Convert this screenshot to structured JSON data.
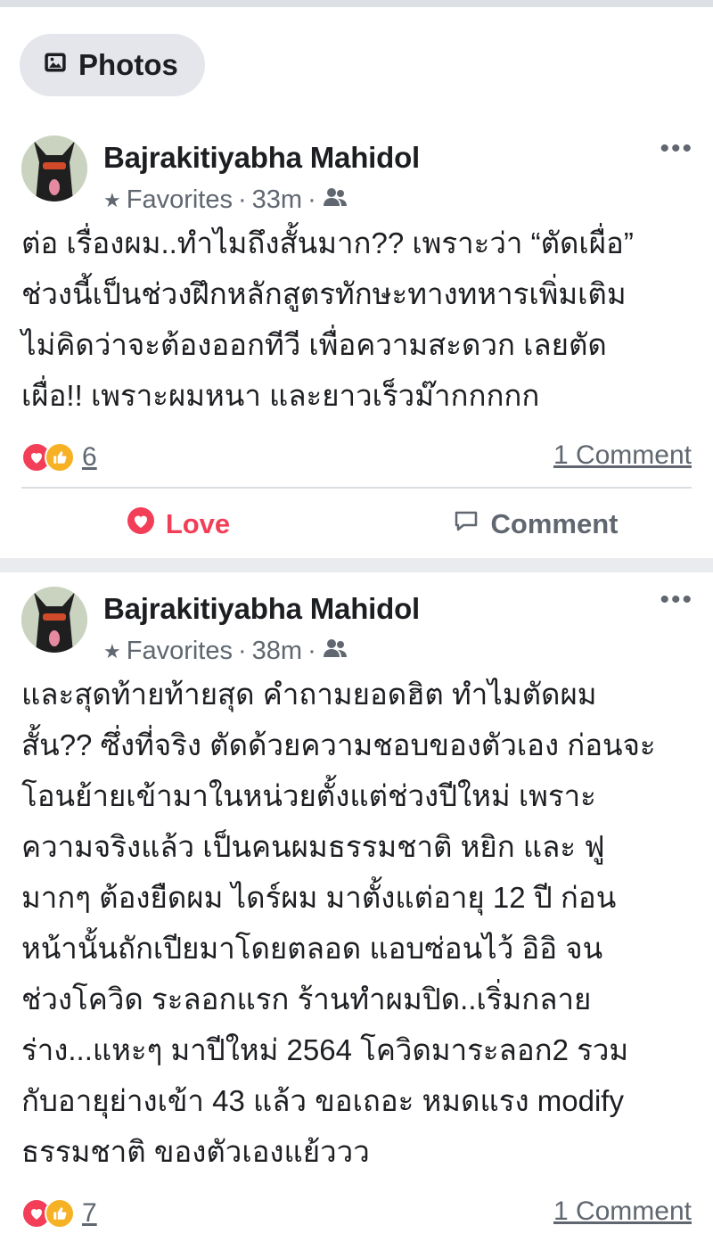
{
  "photos_chip": {
    "label": "Photos",
    "icon": "photos-icon"
  },
  "posts": [
    {
      "author": "Bajrakitiyabha Mahidol",
      "audience": "Favorites",
      "time": "33m",
      "separator": "·",
      "text": "ต่อ เรื่องผม..ทำไมถึงสั้นมาก?? เพราะว่า “ตัดเผื่อ”\nช่วงนี้เป็นช่วงฝึกหลักสูตรทักษะทางทหารเพิ่มเติม\nไม่คิดว่าจะต้องออกทีวี เพื่อความสะดวก เลยตัด\nเผื่อ!! เพราะผมหนา และยาวเร็วม๊ากกกกก",
      "reaction_count": "6",
      "comment_count": "1 Comment",
      "love_label": "Love",
      "comment_label": "Comment"
    },
    {
      "author": "Bajrakitiyabha Mahidol",
      "audience": "Favorites",
      "time": "38m",
      "separator": "·",
      "text": "และสุดท้ายท้ายสุด คำถามยอดฮิต ทำไมตัดผม\nสั้น?? ซึ่งที่จริง ตัดด้วยความชอบของตัวเอง ก่อนจะ\nโอนย้ายเข้ามาในหน่วยตั้งแต่ช่วงปีใหม่ เพราะ\nความจริงแล้ว เป็นคนผมธรรมชาติ หยิก และ ฟู\nมากๆ ต้องยืดผม ไดร์ผม มาตั้งแต่อายุ 12 ปี ก่อน\nหน้านั้นถักเปียมาโดยตลอด แอบซ่อนไว้ อิอิ จน\nช่วงโควิด ระลอกแรก ร้านทำผมปิด..เริ่มกลาย\nร่าง...แหะๆ มาปีใหม่ 2564 โควิดมาระลอก2 รวม\nกับอายุย่างเข้า 43 แล้ว ขอเถอะ หมดแรง modify\nธรรมชาติ ของตัวเองแย้ววว",
      "reaction_count": "7",
      "comment_count": "1 Comment"
    }
  ],
  "colors": {
    "love": "#f33e58",
    "like": "#f7b125",
    "muted": "#606770"
  }
}
